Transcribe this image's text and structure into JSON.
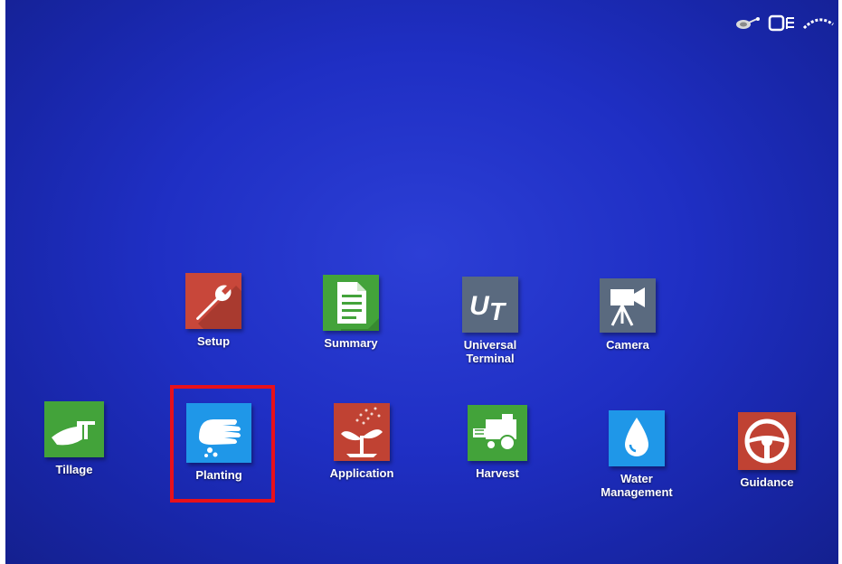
{
  "status_bar": {
    "icons": [
      "antenna-icon",
      "display-icon",
      "signal-icon"
    ]
  },
  "apps_row1": [
    {
      "id": "setup",
      "label": "Setup",
      "color": "#c8473a",
      "icon": "wrench-icon"
    },
    {
      "id": "summary",
      "label": "Summary",
      "color": "#43a33a",
      "icon": "document-icon"
    },
    {
      "id": "universal-terminal",
      "label": "Universal\nTerminal",
      "color": "#5a6a7f",
      "icon": "ut-icon"
    },
    {
      "id": "camera",
      "label": "Camera",
      "color": "#5a6a7f",
      "icon": "video-camera-icon"
    }
  ],
  "apps_row2": [
    {
      "id": "tillage",
      "label": "Tillage",
      "color": "#43a33a",
      "icon": "plow-icon"
    },
    {
      "id": "planting",
      "label": "Planting",
      "color": "#1f97e8",
      "icon": "hand-seed-icon",
      "selected": true
    },
    {
      "id": "application",
      "label": "Application",
      "color": "#c04233",
      "icon": "sprout-spray-icon"
    },
    {
      "id": "harvest",
      "label": "Harvest",
      "color": "#43a33a",
      "icon": "combine-icon"
    },
    {
      "id": "water-management",
      "label": "Water\nManagement",
      "color": "#1f97e8",
      "icon": "water-drop-icon"
    },
    {
      "id": "guidance",
      "label": "Guidance",
      "color": "#c04233",
      "icon": "steering-wheel-icon"
    }
  ],
  "colors": {
    "background": "#1f2fc4",
    "selection": "#e8101a"
  }
}
